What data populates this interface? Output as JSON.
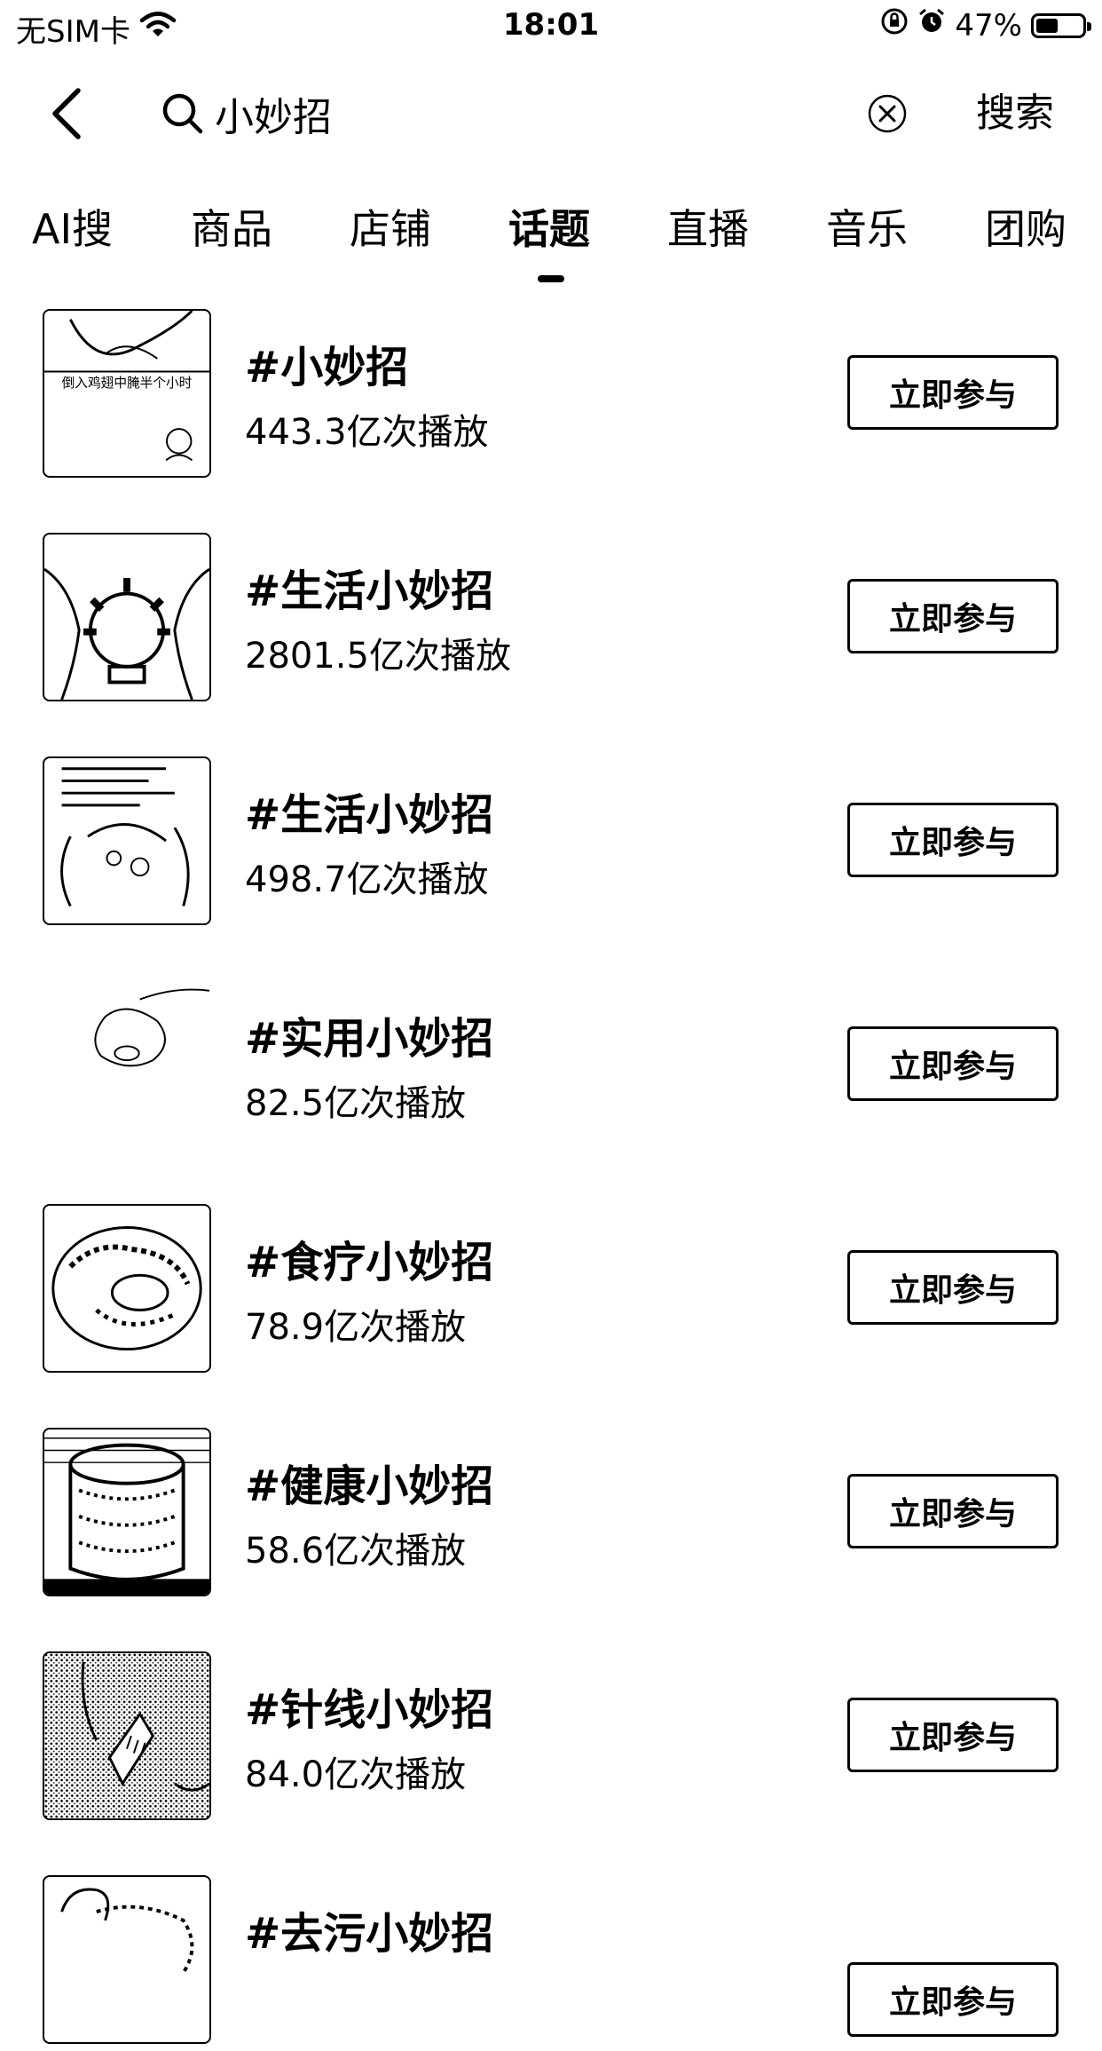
{
  "status_bar": {
    "carrier": "无SIM卡",
    "time": "18:01",
    "battery": "47%",
    "battery_level": 0.47,
    "icons": [
      "wifi-icon",
      "orientation-lock-icon",
      "alarm-icon",
      "battery-icon"
    ]
  },
  "search": {
    "query": "小妙招",
    "search_button": "搜索",
    "icons": [
      "back-icon",
      "search-icon",
      "clear-icon"
    ]
  },
  "tabs": [
    {
      "label": "AI搜",
      "active": false
    },
    {
      "label": "商品",
      "active": false
    },
    {
      "label": "店铺",
      "active": false
    },
    {
      "label": "话题",
      "active": true
    },
    {
      "label": "直播",
      "active": false
    },
    {
      "label": "音乐",
      "active": false
    },
    {
      "label": "团购",
      "active": false
    }
  ],
  "topics": [
    {
      "title": "#小妙招",
      "count": "443.3亿次播放",
      "button": "立即参与",
      "thumb_caption": "倒入鸡翅中腌半个小时"
    },
    {
      "title": "#生活小妙招",
      "count": "2801.5亿次播放",
      "button": "立即参与"
    },
    {
      "title": "#生活小妙招",
      "count": "498.7亿次播放",
      "button": "立即参与"
    },
    {
      "title": "#实用小妙招",
      "count": "82.5亿次播放",
      "button": "立即参与"
    },
    {
      "title": "#食疗小妙招",
      "count": "78.9亿次播放",
      "button": "立即参与"
    },
    {
      "title": "#健康小妙招",
      "count": "58.6亿次播放",
      "button": "立即参与"
    },
    {
      "title": "#针线小妙招",
      "count": "84.0亿次播放",
      "button": "立即参与"
    },
    {
      "title": "#去污小妙招",
      "count": "",
      "button": "立即参与"
    }
  ],
  "colors": {
    "background": "#ffffff",
    "foreground": "#000000"
  }
}
